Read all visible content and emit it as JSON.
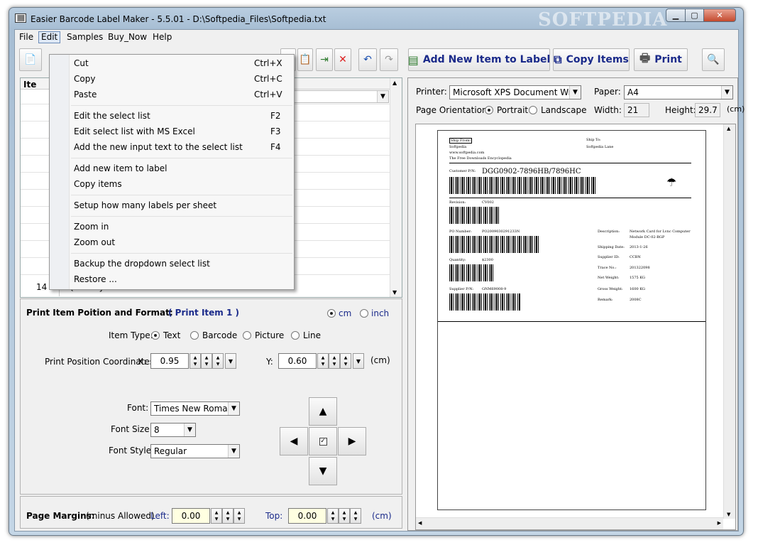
{
  "window": {
    "title": "Easier Barcode Label Maker - 5.5.01  -   D:\\Softpedia_Files\\Softpedia.txt",
    "watermark": "SOFTPEDIA",
    "minimize": "▁",
    "maximize": "▢",
    "close": "✕"
  },
  "menubar": [
    "File",
    "Edit",
    "Samples",
    "Buy_Now",
    "Help"
  ],
  "edit_menu": {
    "items": [
      {
        "label": "Cut",
        "shortcut": "Ctrl+X"
      },
      {
        "label": "Copy",
        "shortcut": "Ctrl+C"
      },
      {
        "label": "Paste",
        "shortcut": "Ctrl+V"
      },
      {
        "label": "Edit the select list",
        "shortcut": "F2"
      },
      {
        "label": "Edit select list with MS Excel",
        "shortcut": "F3"
      },
      {
        "label": "Add the new input text to the select list",
        "shortcut": "F4"
      },
      {
        "label": "Add new item to label",
        "shortcut": ""
      },
      {
        "label": "Copy items",
        "shortcut": ""
      },
      {
        "label": "Setup how many labels per sheet",
        "shortcut": ""
      },
      {
        "label": "Zoom in",
        "shortcut": ""
      },
      {
        "label": "Zoom out",
        "shortcut": ""
      },
      {
        "label": "Backup the dropdown select list",
        "shortcut": ""
      },
      {
        "label": "Restore ...",
        "shortcut": ""
      }
    ]
  },
  "toolbar": {
    "add_new_item": "Add New Item to Label",
    "copy_items": "Copy Items",
    "print": "Print"
  },
  "grid": {
    "header_partial": "Ite",
    "last_row_num": "14",
    "last_row_text": "Quantity:"
  },
  "format": {
    "title": "Print Item Poition and Format:",
    "current_item": "( Print Item 1 )",
    "unit_cm": "cm",
    "unit_inch": "inch",
    "item_type_label": "Item Type:",
    "types": [
      "Text",
      "Barcode",
      "Picture",
      "Line"
    ],
    "coords_label": "Print Position Coordinates",
    "x_label": "X:",
    "x_value": "0.95",
    "y_label": "Y:",
    "y_value": "0.60",
    "coords_unit": "(cm)",
    "font_label": "Font:",
    "font_value": "Times New Roman",
    "font_size_label": "Font Size:",
    "font_size_value": "8",
    "font_style_label": "Font Style:",
    "font_style_value": "Regular"
  },
  "margins": {
    "title": "Page Margins:",
    "note": "(minus Allowed)",
    "left_label": "Left:",
    "left_value": "0.00",
    "top_label": "Top:",
    "top_value": "0.00",
    "unit": "(cm)"
  },
  "printer": {
    "printer_label": "Printer:",
    "printer_value": "Microsoft XPS Document Writer",
    "paper_label": "Paper:",
    "paper_value": "A4",
    "orientation_label": "Page Orientation:",
    "portrait": "Portrait",
    "landscape": "Landscape",
    "width_label": "Width:",
    "width_value": "21",
    "height_label": "Height:",
    "height_value": "29.7",
    "unit": "(cm)"
  },
  "label": {
    "ship_from": "Ship From:",
    "from_name": "Softpedia",
    "from_url": "www.softpedia.com",
    "from_tagline": "The Free Downloads Encyclopedia",
    "ship_to": "Ship To:",
    "to_name": "Softpedia Lane",
    "customer_pn_label": "Customer P/N:",
    "customer_pn": "DGG0902-7896HB/7896HC",
    "revision_label": "Revision:",
    "revision": "CV002",
    "po_label": "PO Number:",
    "po": "PO2009030291233N",
    "quantity_label": "Quantity:",
    "quantity": "$2300",
    "supplier_pn_label": "Supplier P/N:",
    "supplier_pn": "GNM69008-9",
    "desc_label": "Description:",
    "desc": "Network Card for Lvnc Computer",
    "desc2": "Module DC-02-RGP",
    "ship_date_label": "Shipping Date:",
    "ship_date": "2013-1-26",
    "supplier_id_label": "Supplier ID:",
    "supplier_id": "CCBN",
    "trace_label": "Trace No.:",
    "trace": "201322098",
    "net_weight_label": "Net Weight:",
    "net_weight": "1575 KG",
    "gross_weight_label": "Gross Weight:",
    "gross_weight": "1600 KG",
    "remark_label": "Remark:",
    "remark": "2008C"
  }
}
